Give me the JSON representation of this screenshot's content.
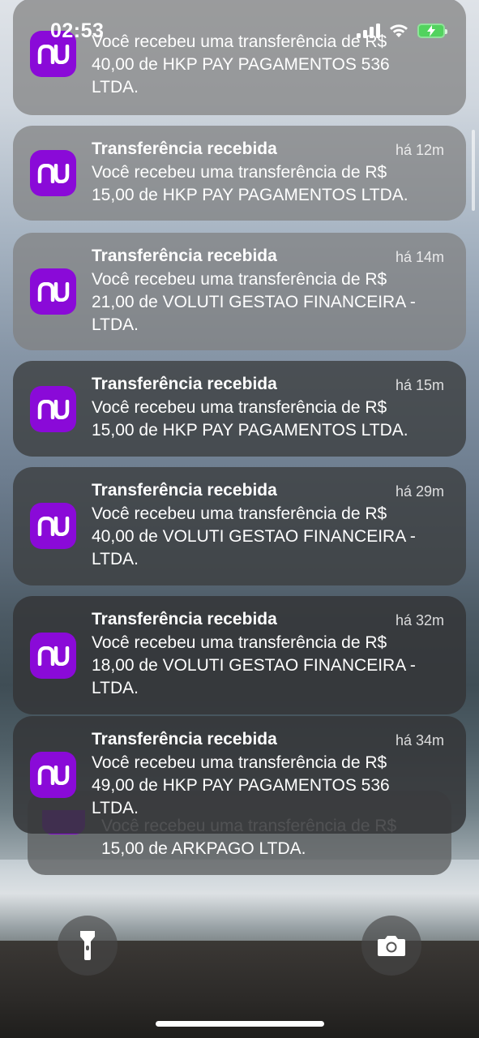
{
  "status_bar": {
    "time": "02:53"
  },
  "app": {
    "name": "nu",
    "brand_color": "#8a0ad8"
  },
  "notifications": [
    {
      "title": "",
      "time_ago": "",
      "body": "Você recebeu uma transferência de R$\n40,00 de HKP PAY PAGAMENTOS 536\nLTDA."
    },
    {
      "title": "Transferência recebida",
      "time_ago": "há 12m",
      "body": "Você recebeu uma transferência de R$\n15,00 de HKP PAY PAGAMENTOS LTDA."
    },
    {
      "title": "Transferência recebida",
      "time_ago": "há 14m",
      "body": "Você recebeu uma transferência de R$\n21,00 de VOLUTI GESTAO FINANCEIRA -\nLTDA."
    },
    {
      "title": "Transferência recebida",
      "time_ago": "há 15m",
      "body": "Você recebeu uma transferência de R$\n15,00 de HKP PAY PAGAMENTOS LTDA."
    },
    {
      "title": "Transferência recebida",
      "time_ago": "há 29m",
      "body": "Você recebeu uma transferência de R$\n40,00 de VOLUTI GESTAO FINANCEIRA -\nLTDA."
    },
    {
      "title": "Transferência recebida",
      "time_ago": "há 32m",
      "body": "Você recebeu uma transferência de R$\n18,00 de VOLUTI GESTAO FINANCEIRA -\nLTDA."
    },
    {
      "title": "Transferência recebida",
      "time_ago": "há 34m",
      "body": "Você recebeu uma transferência de R$\n49,00 de HKP PAY PAGAMENTOS 536\nLTDA."
    }
  ],
  "stacked_notification": {
    "body": "Você recebeu uma transferência de R$\n15,00 de ARKPAGO LTDA."
  },
  "icons": {
    "flashlight": "flashlight-icon",
    "camera": "camera-icon"
  }
}
